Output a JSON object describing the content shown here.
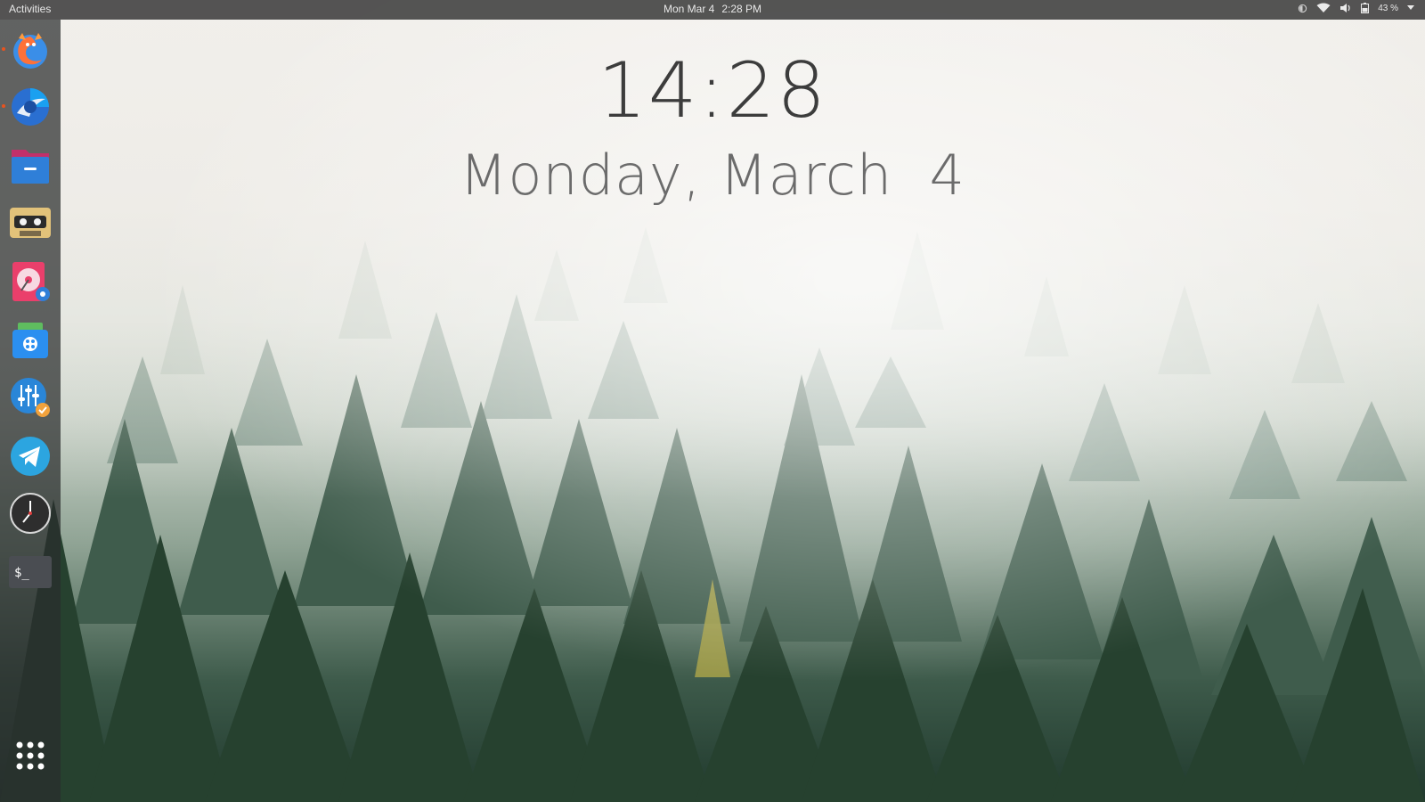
{
  "topbar": {
    "activities_label": "Activities",
    "date": "Mon Mar 4",
    "time": "2:28 PM",
    "battery_percent": "43 %",
    "tray_icons": [
      "night-light-icon",
      "wifi-icon",
      "volume-icon",
      "battery-icon",
      "chevron-down-icon"
    ]
  },
  "desktop_clock": {
    "time": "14:28",
    "date": "Monday, March  4"
  },
  "dock": {
    "items": [
      {
        "name": "firefox",
        "icon": "firefox-icon",
        "running": true
      },
      {
        "name": "browser",
        "icon": "browser-icon",
        "running": true
      },
      {
        "name": "files",
        "icon": "files-icon",
        "running": false
      },
      {
        "name": "cassette-player",
        "icon": "cassette-icon",
        "running": false
      },
      {
        "name": "disk-utility",
        "icon": "disk-settings-icon",
        "running": false
      },
      {
        "name": "software-store",
        "icon": "store-icon",
        "running": false
      },
      {
        "name": "tweaks",
        "icon": "sliders-icon",
        "running": false
      },
      {
        "name": "telegram",
        "icon": "telegram-icon",
        "running": false
      },
      {
        "name": "clocks",
        "icon": "clock-icon",
        "running": false
      },
      {
        "name": "terminal",
        "icon": "terminal-icon",
        "running": false
      }
    ],
    "show_apps_icon": "app-grid-icon",
    "terminal_prompt": "$_"
  },
  "colors": {
    "topbar_bg": "#3e3e3e",
    "running_indicator": "#e9531e",
    "clock_text": "#3c3c3c"
  }
}
